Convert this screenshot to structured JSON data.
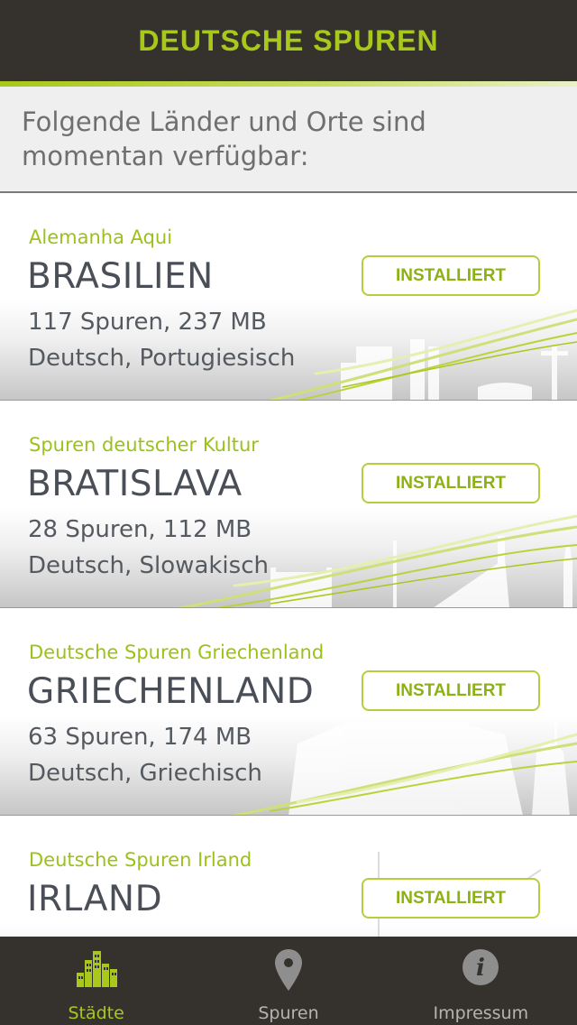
{
  "header": {
    "title": "DEUTSCHE SPUREN"
  },
  "intro": {
    "text": "Folgende Länder und Orte sind momentan verfügbar:"
  },
  "places": [
    {
      "subtitle": "Alemanha Aqui",
      "name": "BRASILIEN",
      "stats": "117 Spuren, 237 MB",
      "languages": "Deutsch, Portugiesisch",
      "button": "INSTALLIERT"
    },
    {
      "subtitle": "Spuren deutscher Kultur",
      "name": "BRATISLAVA",
      "stats": "28 Spuren, 112 MB",
      "languages": "Deutsch, Slowakisch",
      "button": "INSTALLIERT"
    },
    {
      "subtitle": "Deutsche Spuren Griechenland",
      "name": "GRIECHENLAND",
      "stats": "63 Spuren, 174 MB",
      "languages": "Deutsch, Griechisch",
      "button": "INSTALLIERT"
    },
    {
      "subtitle": "Deutsche Spuren Irland",
      "name": "IRLAND",
      "button": "INSTALLIERT"
    }
  ],
  "tabbar": {
    "tabs": [
      {
        "label": "Städte",
        "icon": "city-icon",
        "active": true
      },
      {
        "label": "Spuren",
        "icon": "map-pin-icon",
        "active": false
      },
      {
        "label": "Impressum",
        "icon": "info-icon",
        "active": false
      }
    ]
  },
  "colors": {
    "accent": "#a8c81c",
    "header_bg": "#35322d",
    "text": "#4a4f57"
  }
}
